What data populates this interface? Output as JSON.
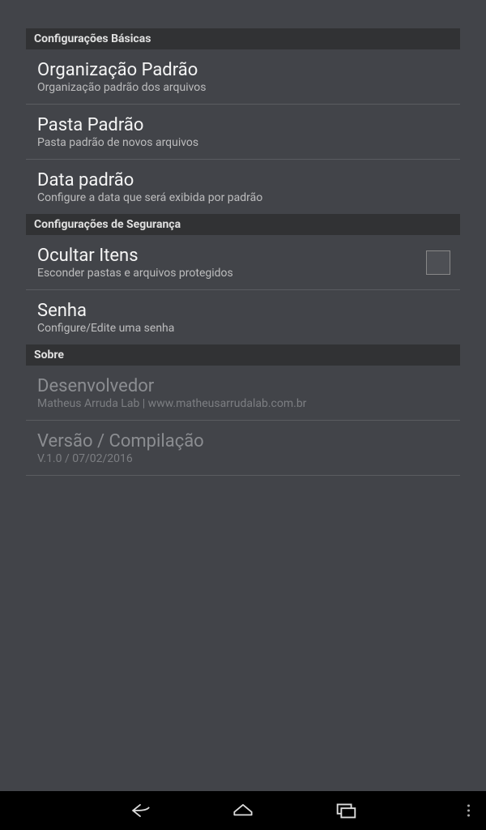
{
  "sections": {
    "basic": {
      "header": "Configurações Básicas",
      "items": {
        "org": {
          "title": "Organização Padrão",
          "subtitle": "Organização padrão dos arquivos"
        },
        "folder": {
          "title": "Pasta Padrão",
          "subtitle": "Pasta padrão de novos arquivos"
        },
        "date": {
          "title": "Data padrão",
          "subtitle": "Configure a data que será exibida por padrão"
        }
      }
    },
    "security": {
      "header": "Configurações de Segurança",
      "items": {
        "hide": {
          "title": "Ocultar Itens",
          "subtitle": "Esconder pastas e arquivos protegidos"
        },
        "password": {
          "title": "Senha",
          "subtitle": "Configure/Edite uma senha"
        }
      }
    },
    "about": {
      "header": "Sobre",
      "items": {
        "developer": {
          "title": "Desenvolvedor",
          "subtitle": "Matheus Arruda Lab | www.matheusarrudalab.com.br"
        },
        "version": {
          "title": "Versão / Compilação",
          "subtitle": "V.1.0 / 07/02/2016"
        }
      }
    }
  }
}
